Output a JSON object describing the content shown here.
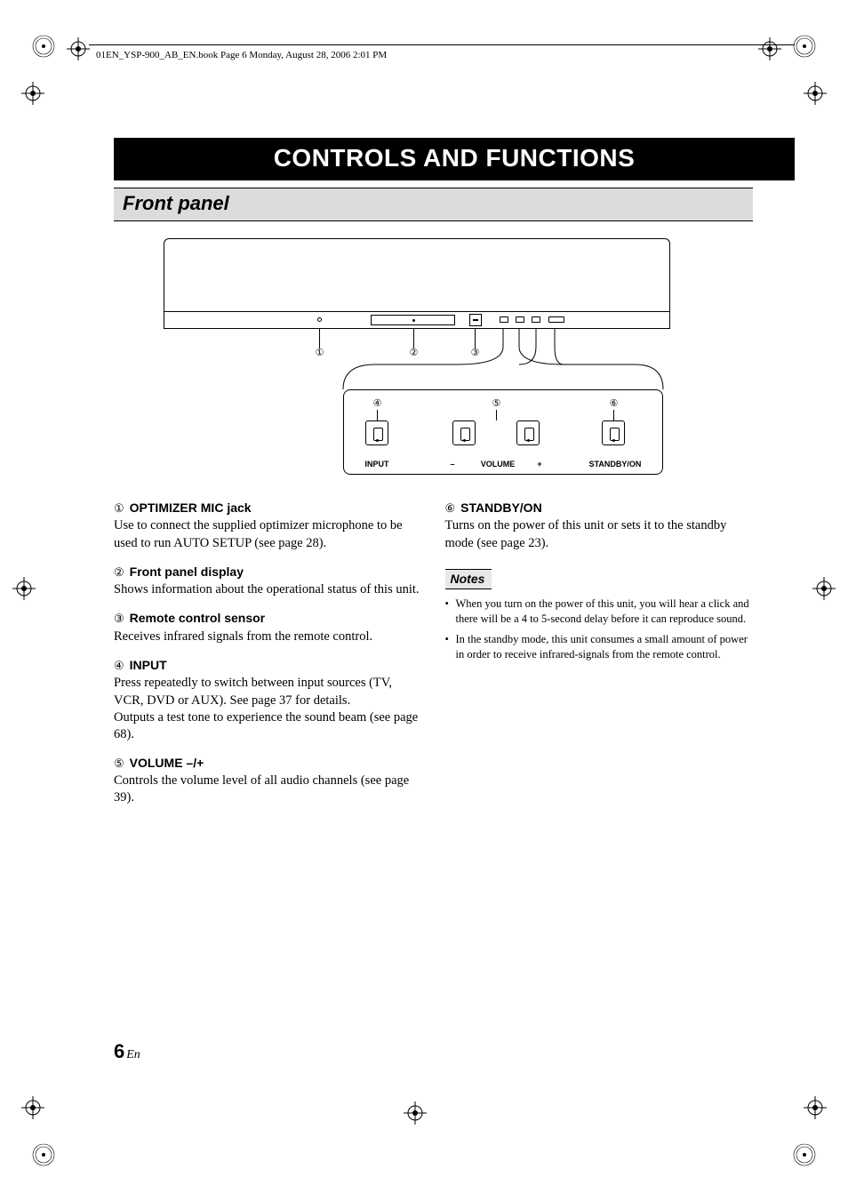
{
  "header": {
    "booktag": "01EN_YSP-900_AB_EN.book  Page 6  Monday, August 28, 2006  2:01 PM"
  },
  "title": "CONTROLS AND FUNCTIONS",
  "subsection": "Front panel",
  "diagram": {
    "callouts": [
      "1",
      "2",
      "3",
      "4",
      "5",
      "6"
    ],
    "labels": {
      "input": "INPUT",
      "minus": "–",
      "volume": "VOLUME",
      "plus": "+",
      "standby": "STANDBY/ON"
    }
  },
  "left_items": [
    {
      "num": "①",
      "title": "OPTIMIZER MIC jack",
      "body": "Use to connect the supplied optimizer microphone to be used to run AUTO SETUP (see page 28)."
    },
    {
      "num": "②",
      "title": "Front panel display",
      "body": "Shows information about the operational status of this unit."
    },
    {
      "num": "③",
      "title": "Remote control sensor",
      "body": "Receives infrared signals from the remote control."
    },
    {
      "num": "④",
      "title": "INPUT",
      "body": "Press repeatedly to switch between input sources (TV, VCR, DVD or AUX). See page 37 for details.\nOutputs a test tone to experience the sound beam (see page 68)."
    },
    {
      "num": "⑤",
      "title": "VOLUME –/+",
      "body": "Controls the volume level of all audio channels (see page 39)."
    }
  ],
  "right_items": [
    {
      "num": "⑥",
      "title": "STANDBY/ON",
      "body": "Turns on the power of this unit or sets it to the standby mode (see page 23)."
    }
  ],
  "notes_label": "Notes",
  "notes": [
    "When you turn on the power of this unit, you will hear a click and there will be a 4 to 5-second delay before it can reproduce sound.",
    "In the standby mode, this unit consumes a small amount of power in order to receive infrared-signals from the remote control."
  ],
  "page": {
    "number": "6",
    "lang": "En"
  }
}
